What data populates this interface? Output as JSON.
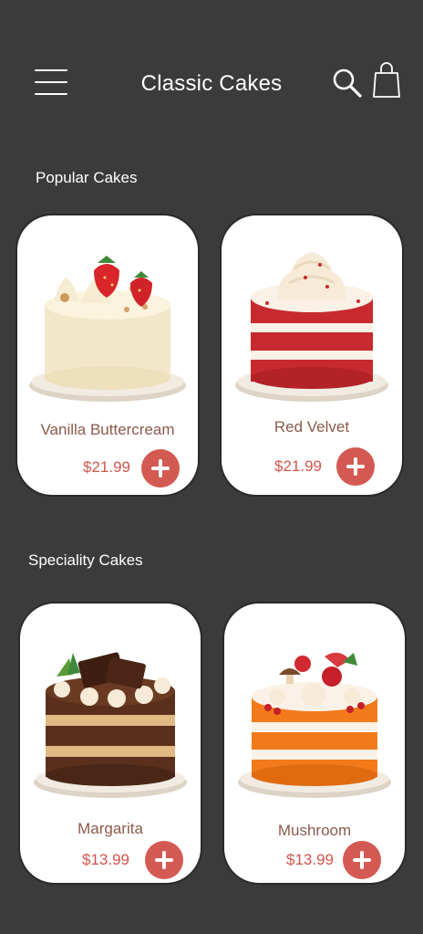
{
  "header": {
    "title": "Classic Cakes"
  },
  "sections": {
    "popular": {
      "title": "Popular Cakes"
    },
    "speciality": {
      "title": "Speciality Cakes"
    }
  },
  "products": {
    "vanilla": {
      "name": "Vanilla Buttercream",
      "price": "$21.99"
    },
    "red_velvet": {
      "name": "Red Velvet",
      "price": "$21.99"
    },
    "margarita": {
      "name": "Margarita",
      "price": "$13.99"
    },
    "mushroom": {
      "name": "Mushroom",
      "price": "$13.99"
    }
  },
  "icons": {
    "menu": "hamburger-menu-icon",
    "search": "search-icon",
    "bag": "shopping-bag-icon",
    "add": "plus-icon"
  },
  "colors": {
    "background": "#3b3b3b",
    "card": "#ffffff",
    "accent": "#d35a52",
    "price": "#d0564c",
    "product_name": "#8b5a4a"
  }
}
